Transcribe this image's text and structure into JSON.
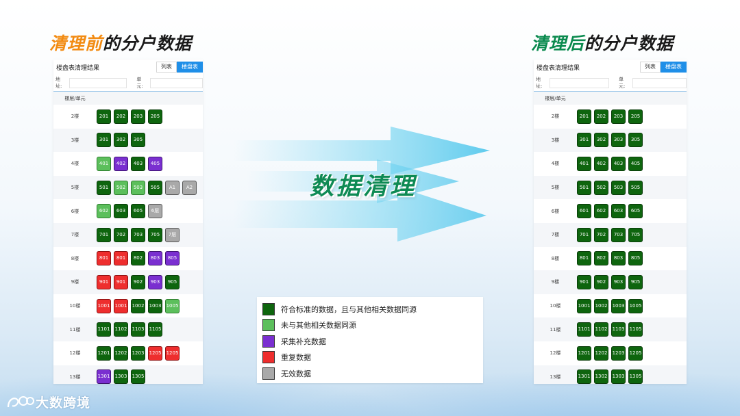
{
  "left_title": {
    "highlight": "清理前",
    "rest": "的分户数据"
  },
  "right_title": {
    "highlight": "清理后",
    "rest": "的分户数据"
  },
  "center_title": "数据清理",
  "panel": {
    "title": "楼盘表清理结果",
    "tab_list": "列表",
    "tab_building": "楼盘表",
    "address_label": "地址:",
    "unit_label": "单元:",
    "column_header": "楼层/单元"
  },
  "colors": {
    "standard": "#0e650e",
    "not_same_source": "#5cbf5c",
    "supplemented": "#7a2fd0",
    "duplicate": "#ee2e2e",
    "invalid": "#a9a9a9"
  },
  "before_rows": [
    {
      "floor": "2楼",
      "units": [
        [
          "201",
          "standard"
        ],
        [
          "202",
          "standard"
        ],
        [
          "203",
          "standard"
        ],
        [
          "205",
          "standard"
        ]
      ]
    },
    {
      "floor": "3楼",
      "units": [
        [
          "301",
          "standard"
        ],
        [
          "302",
          "standard"
        ],
        [
          "305",
          "standard"
        ]
      ]
    },
    {
      "floor": "4楼",
      "units": [
        [
          "401",
          "not_same_source"
        ],
        [
          "402",
          "supplemented"
        ],
        [
          "403",
          "standard"
        ],
        [
          "405",
          "supplemented"
        ]
      ]
    },
    {
      "floor": "5楼",
      "units": [
        [
          "501",
          "standard"
        ],
        [
          "502",
          "not_same_source"
        ],
        [
          "503",
          "not_same_source"
        ],
        [
          "505",
          "standard"
        ],
        [
          "A1",
          "invalid"
        ],
        [
          "A2",
          "invalid"
        ]
      ]
    },
    {
      "floor": "6楼",
      "units": [
        [
          "602",
          "not_same_source"
        ],
        [
          "603",
          "standard"
        ],
        [
          "605",
          "standard"
        ],
        [
          "6层",
          "invalid"
        ]
      ]
    },
    {
      "floor": "7楼",
      "units": [
        [
          "701",
          "standard"
        ],
        [
          "702",
          "standard"
        ],
        [
          "703",
          "standard"
        ],
        [
          "705",
          "standard"
        ],
        [
          "7层",
          "invalid"
        ]
      ]
    },
    {
      "floor": "8楼",
      "units": [
        [
          "801",
          "duplicate"
        ],
        [
          "801",
          "duplicate"
        ],
        [
          "802",
          "standard"
        ],
        [
          "803",
          "supplemented"
        ],
        [
          "805",
          "supplemented"
        ]
      ]
    },
    {
      "floor": "9楼",
      "units": [
        [
          "901",
          "duplicate"
        ],
        [
          "901",
          "duplicate"
        ],
        [
          "902",
          "standard"
        ],
        [
          "903",
          "supplemented"
        ],
        [
          "905",
          "standard"
        ]
      ]
    },
    {
      "floor": "10楼",
      "units": [
        [
          "1001",
          "duplicate"
        ],
        [
          "1001",
          "duplicate"
        ],
        [
          "1002",
          "standard"
        ],
        [
          "1003",
          "standard"
        ],
        [
          "1005",
          "not_same_source"
        ]
      ]
    },
    {
      "floor": "11楼",
      "units": [
        [
          "1101",
          "standard"
        ],
        [
          "1102",
          "standard"
        ],
        [
          "1103",
          "standard"
        ],
        [
          "1105",
          "standard"
        ]
      ]
    },
    {
      "floor": "12楼",
      "units": [
        [
          "1201",
          "standard"
        ],
        [
          "1202",
          "standard"
        ],
        [
          "1203",
          "standard"
        ],
        [
          "1205",
          "duplicate"
        ],
        [
          "1205",
          "duplicate"
        ]
      ]
    },
    {
      "floor": "13楼",
      "units": [
        [
          "1301",
          "supplemented"
        ],
        [
          "1303",
          "standard"
        ],
        [
          "1305",
          "standard"
        ]
      ]
    }
  ],
  "after_rows": [
    {
      "floor": "2楼",
      "units": [
        [
          "201",
          "standard"
        ],
        [
          "202",
          "standard"
        ],
        [
          "203",
          "standard"
        ],
        [
          "205",
          "standard"
        ]
      ]
    },
    {
      "floor": "3楼",
      "units": [
        [
          "301",
          "standard"
        ],
        [
          "302",
          "standard"
        ],
        [
          "303",
          "standard"
        ],
        [
          "305",
          "standard"
        ]
      ]
    },
    {
      "floor": "4楼",
      "units": [
        [
          "401",
          "standard"
        ],
        [
          "402",
          "standard"
        ],
        [
          "403",
          "standard"
        ],
        [
          "405",
          "standard"
        ]
      ]
    },
    {
      "floor": "5楼",
      "units": [
        [
          "501",
          "standard"
        ],
        [
          "502",
          "standard"
        ],
        [
          "503",
          "standard"
        ],
        [
          "505",
          "standard"
        ]
      ]
    },
    {
      "floor": "6楼",
      "units": [
        [
          "601",
          "standard"
        ],
        [
          "602",
          "standard"
        ],
        [
          "603",
          "standard"
        ],
        [
          "605",
          "standard"
        ]
      ]
    },
    {
      "floor": "7楼",
      "units": [
        [
          "701",
          "standard"
        ],
        [
          "702",
          "standard"
        ],
        [
          "703",
          "standard"
        ],
        [
          "705",
          "standard"
        ]
      ]
    },
    {
      "floor": "8楼",
      "units": [
        [
          "801",
          "standard"
        ],
        [
          "802",
          "standard"
        ],
        [
          "803",
          "standard"
        ],
        [
          "805",
          "standard"
        ]
      ]
    },
    {
      "floor": "9楼",
      "units": [
        [
          "901",
          "standard"
        ],
        [
          "902",
          "standard"
        ],
        [
          "903",
          "standard"
        ],
        [
          "905",
          "standard"
        ]
      ]
    },
    {
      "floor": "10楼",
      "units": [
        [
          "1001",
          "standard"
        ],
        [
          "1002",
          "standard"
        ],
        [
          "1003",
          "standard"
        ],
        [
          "1005",
          "standard"
        ]
      ]
    },
    {
      "floor": "11楼",
      "units": [
        [
          "1101",
          "standard"
        ],
        [
          "1102",
          "standard"
        ],
        [
          "1103",
          "standard"
        ],
        [
          "1105",
          "standard"
        ]
      ]
    },
    {
      "floor": "12楼",
      "units": [
        [
          "1201",
          "standard"
        ],
        [
          "1202",
          "standard"
        ],
        [
          "1203",
          "standard"
        ],
        [
          "1205",
          "standard"
        ]
      ]
    },
    {
      "floor": "13楼",
      "units": [
        [
          "1301",
          "standard"
        ],
        [
          "1302",
          "standard"
        ],
        [
          "1303",
          "standard"
        ],
        [
          "1305",
          "standard"
        ]
      ]
    }
  ],
  "legend": [
    {
      "type": "standard",
      "label": "符合标准的数据，且与其他相关数据同源"
    },
    {
      "type": "not_same_source",
      "label": "未与其他相关数据同源"
    },
    {
      "type": "supplemented",
      "label": "采集补充数据"
    },
    {
      "type": "duplicate",
      "label": "重复数据"
    },
    {
      "type": "invalid",
      "label": "无效数据"
    }
  ],
  "brand": "大数跨境"
}
